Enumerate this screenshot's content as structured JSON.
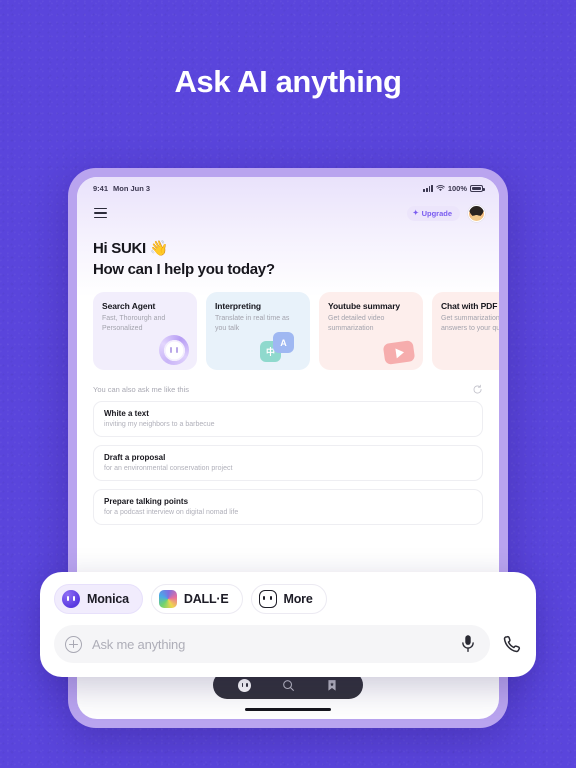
{
  "headline": "Ask AI anything",
  "colors": {
    "background": "#5a45dc",
    "device_bezel": "#b9a4ef",
    "accent": "#7a5cf0",
    "nav_pill": "#34343c"
  },
  "statusbar": {
    "time": "9:41",
    "date": "Mon Jun 3",
    "battery_percent": "100%",
    "signal_icon": "signal-bars-icon",
    "wifi_icon": "wifi-icon",
    "battery_icon": "battery-icon"
  },
  "appbar": {
    "menu_icon": "hamburger-menu-icon",
    "upgrade_label": "Upgrade",
    "upgrade_icon": "sparkle-icon",
    "avatar_icon": "user-avatar"
  },
  "greeting": {
    "line1": "Hi SUKI 👋",
    "line2": "How can I help you today?"
  },
  "cards": [
    {
      "title": "Search Agent",
      "subtitle": "Fast, Thorourgh and Personalized",
      "icon": "monica-face-icon",
      "color": "#f2eefc"
    },
    {
      "title": "Interpreting",
      "subtitle": "Translate in real time as you talk",
      "icon": "translate-icon",
      "icon_left_text": "中",
      "icon_right_text": "A",
      "color": "#e8f2fa"
    },
    {
      "title": "Youtube summary",
      "subtitle": "Get detailed video summarization",
      "icon": "youtube-play-icon",
      "color": "#fdeeec"
    },
    {
      "title": "Chat with PDF",
      "subtitle": "Get summarization and answers to your question",
      "icon": "pdf-icon",
      "color": "#fdeeec"
    }
  ],
  "suggestions": {
    "label": "You can also ask me like this",
    "refresh_icon": "refresh-icon",
    "items": [
      {
        "title": "White a text",
        "subtitle": "inviting my neighbors to a barbecue"
      },
      {
        "title": "Draft a proposal",
        "subtitle": "for an environmental conservation project"
      },
      {
        "title": "Prepare talking points",
        "subtitle": "for a podcast interview on digital nomad life"
      }
    ]
  },
  "composer": {
    "chips": [
      {
        "label": "Monica",
        "icon": "monica-logo-icon",
        "active": true
      },
      {
        "label": "DALL·E",
        "icon": "dalle-logo-icon",
        "active": false
      },
      {
        "label": "More",
        "icon": "more-models-icon",
        "active": false
      }
    ],
    "input_placeholder": "Ask me anything",
    "input_value": "",
    "add_icon": "plus-circle-icon",
    "mic_icon": "microphone-icon",
    "call_icon": "phone-call-icon"
  },
  "bottomnav": {
    "items": [
      {
        "icon": "chat-face-icon",
        "active": true
      },
      {
        "icon": "search-icon",
        "active": false
      },
      {
        "icon": "bookmark-icon",
        "active": false
      }
    ]
  }
}
